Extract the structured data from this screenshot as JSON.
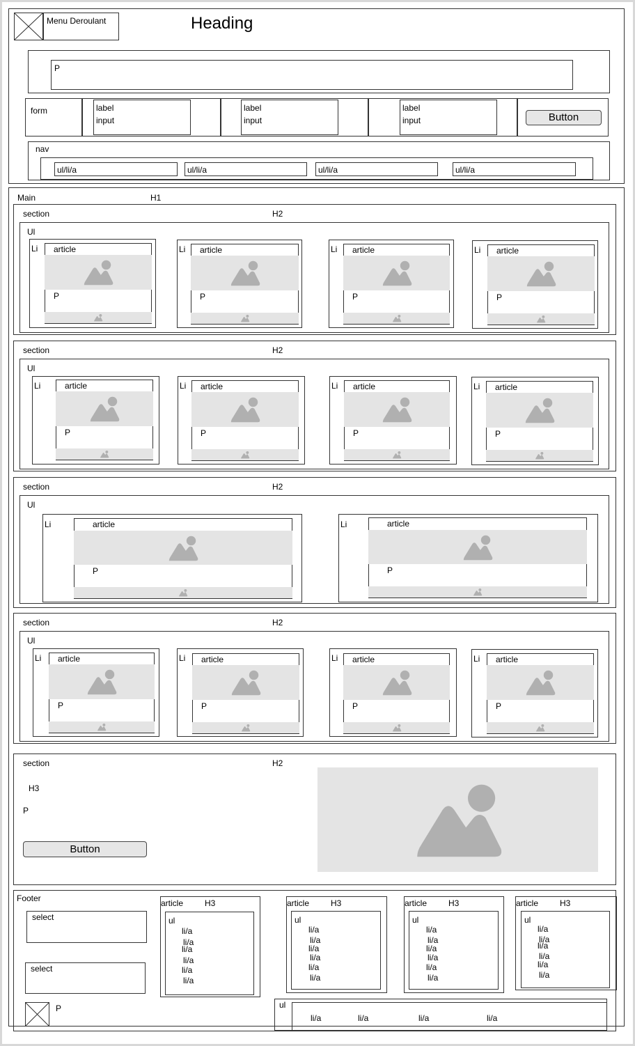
{
  "header": {
    "menu_label": "Menu Deroulant",
    "heading": "Heading",
    "p": "P",
    "form": {
      "label": "form",
      "fields": [
        {
          "label": "label",
          "input": "input"
        },
        {
          "label": "label",
          "input": "input"
        },
        {
          "label": "label",
          "input": "input"
        }
      ],
      "button": "Button"
    },
    "nav": {
      "label": "nav",
      "items": [
        "ul/li/a",
        "ul/li/a",
        "ul/li/a",
        "ul/li/a"
      ]
    }
  },
  "main": {
    "label": "Main",
    "h1": "H1",
    "section_label": "section",
    "h2": "H2",
    "ul": "Ul",
    "li": "Li",
    "article": "article",
    "p": "P",
    "section5": {
      "h3": "H3",
      "p": "P",
      "button": "Button"
    }
  },
  "footer": {
    "label": "Footer",
    "selects": [
      "select",
      "select"
    ],
    "article": "article",
    "h3": "H3",
    "ul": "ul",
    "li": "li/a",
    "p": "P"
  }
}
